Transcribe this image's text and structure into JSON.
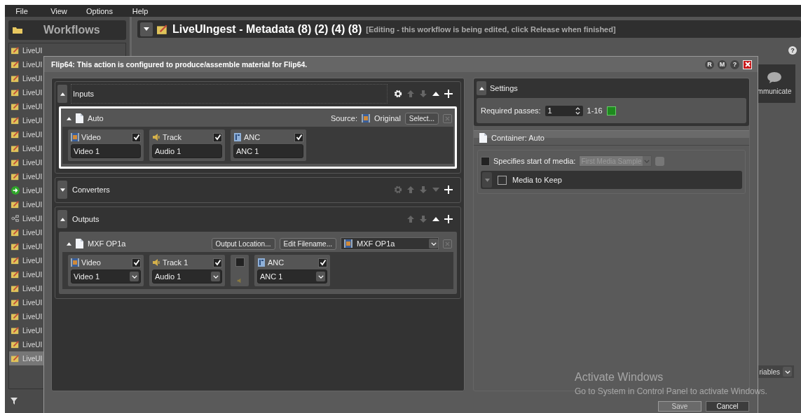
{
  "menu": [
    {
      "label": "File"
    },
    {
      "label": "View"
    },
    {
      "label": "Options"
    },
    {
      "label": "Help"
    }
  ],
  "workflows": {
    "title": "Workflows",
    "items": [
      {
        "label": "LiveUI",
        "kind": "edit",
        "selected": false
      },
      {
        "label": "LiveUI",
        "kind": "edit",
        "selected": false
      },
      {
        "label": "LiveUI",
        "kind": "edit",
        "selected": false
      },
      {
        "label": "LiveUI",
        "kind": "edit",
        "selected": false
      },
      {
        "label": "LiveUI",
        "kind": "edit",
        "selected": false
      },
      {
        "label": "LiveUI",
        "kind": "edit",
        "selected": false
      },
      {
        "label": "LiveUI",
        "kind": "edit",
        "selected": false
      },
      {
        "label": "LiveUI",
        "kind": "edit",
        "selected": false
      },
      {
        "label": "LiveUI",
        "kind": "edit",
        "selected": false
      },
      {
        "label": "LiveUI",
        "kind": "edit",
        "selected": false
      },
      {
        "label": "LiveUI",
        "kind": "run",
        "selected": false
      },
      {
        "label": "LiveUI",
        "kind": "edit",
        "selected": false
      },
      {
        "label": "LiveUI",
        "kind": "flow",
        "selected": false
      },
      {
        "label": "LiveUI",
        "kind": "edit",
        "selected": false
      },
      {
        "label": "LiveUI",
        "kind": "edit",
        "selected": false
      },
      {
        "label": "LiveUI",
        "kind": "edit",
        "selected": false
      },
      {
        "label": "LiveUI",
        "kind": "edit",
        "selected": false
      },
      {
        "label": "LiveUI",
        "kind": "edit",
        "selected": false
      },
      {
        "label": "LiveUI",
        "kind": "edit",
        "selected": false
      },
      {
        "label": "LiveUI",
        "kind": "edit",
        "selected": false
      },
      {
        "label": "LiveUI",
        "kind": "edit",
        "selected": false
      },
      {
        "label": "LiveUI",
        "kind": "edit",
        "selected": false
      },
      {
        "label": "LiveUI",
        "kind": "edit",
        "selected": true
      }
    ]
  },
  "header": {
    "title": "LiveUIngest - Metadata (8) (2) (4) (8)",
    "note": "[Editing - this workflow is being edited, click Release when finished]"
  },
  "background": {
    "help": "?",
    "side_label": "mmunicate",
    "dropdown": "riables"
  },
  "dialog": {
    "title": "Flip64: This action is configured to produce/assemble material for Flip64.",
    "title_buttons": [
      {
        "label": "R"
      },
      {
        "label": "M"
      },
      {
        "label": "?"
      }
    ],
    "sections": [
      {
        "kind": "inputs",
        "title": "Inputs",
        "expanded": true,
        "tools": [
          {
            "kind": "gear",
            "disabled": false
          },
          {
            "kind": "up",
            "disabled": true
          },
          {
            "kind": "down",
            "disabled": true
          },
          {
            "kind": "collapse",
            "disabled": false
          },
          {
            "kind": "add",
            "disabled": false
          }
        ],
        "items": [
          {
            "title": "Auto",
            "selected": true,
            "source_label": "Source:",
            "source": "Original",
            "buttons": [
              "Select..."
            ],
            "tracks": [
              {
                "kind": "video",
                "label": "Video",
                "checked": true,
                "value": "Video 1",
                "dropdown": false
              },
              {
                "kind": "audio",
                "label": "Track",
                "checked": true,
                "value": "Audio 1",
                "dropdown": false
              },
              {
                "kind": "anc",
                "label": "ANC",
                "checked": true,
                "value": "ANC 1",
                "dropdown": false
              }
            ]
          }
        ]
      },
      {
        "kind": "converters",
        "title": "Converters",
        "expanded": false,
        "tools": [
          {
            "kind": "gear",
            "disabled": true
          },
          {
            "kind": "up",
            "disabled": true
          },
          {
            "kind": "down",
            "disabled": true
          },
          {
            "kind": "expand",
            "disabled": true
          },
          {
            "kind": "add",
            "disabled": false
          }
        ]
      },
      {
        "kind": "outputs",
        "title": "Outputs",
        "expanded": true,
        "tools": [
          {
            "kind": "up",
            "disabled": true
          },
          {
            "kind": "down",
            "disabled": true
          },
          {
            "kind": "collapse",
            "disabled": false
          },
          {
            "kind": "add",
            "disabled": false
          }
        ],
        "items": [
          {
            "title": "MXF OP1a",
            "selected": false,
            "buttons": [
              "Output Location...",
              "Edit Filename..."
            ],
            "format": "MXF OP1a",
            "tracks": [
              {
                "kind": "video",
                "label": "Video",
                "checked": true,
                "value": "Video 1",
                "dropdown": true
              },
              {
                "kind": "audio",
                "label": "Track 1",
                "checked": true,
                "value": "Audio 1",
                "dropdown": true
              },
              {
                "kind": "empty",
                "checked": false
              },
              {
                "kind": "anc",
                "label": "ANC",
                "checked": true,
                "value": "ANC 1",
                "dropdown": true
              }
            ]
          }
        ]
      }
    ],
    "settings": {
      "title": "Settings",
      "passes_label": "Required passes:",
      "passes": "1",
      "range": "1-16"
    },
    "container": {
      "title": "Container: Auto",
      "start_label": "Specifies start of media:",
      "start_checked": false,
      "start_value": "First Media Sample",
      "keep_label": "Media to Keep",
      "keep_checked": false
    },
    "footer": {
      "save": "Save",
      "save_disabled": true,
      "cancel": "Cancel"
    }
  },
  "os_notice": {
    "title": "Activate Windows",
    "text": "Go to System in Control Panel to activate Windows."
  }
}
